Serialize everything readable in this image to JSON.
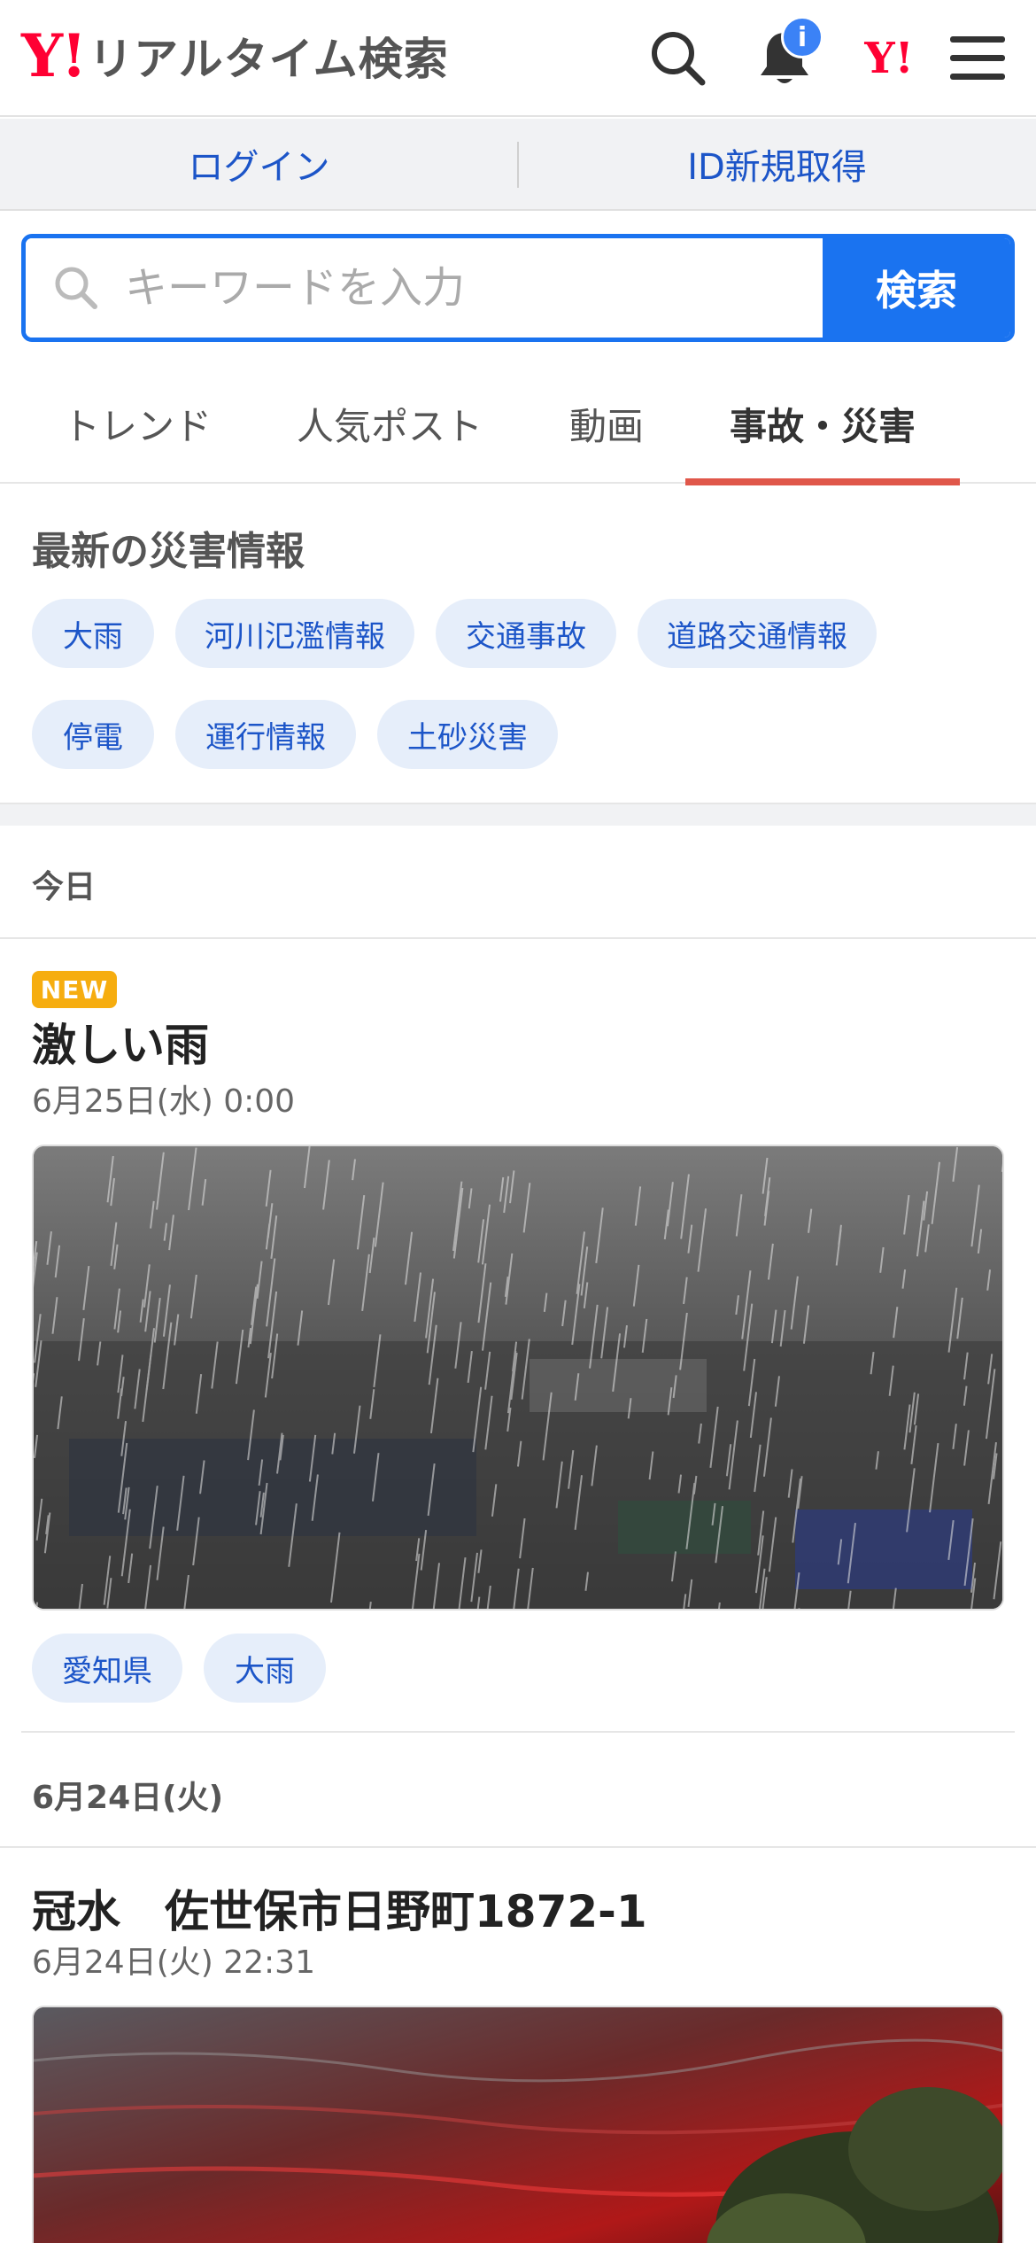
{
  "header": {
    "logo_mark": "Y!",
    "logo_text": "リアルタイム検索",
    "notification_badge": "i",
    "yahoo_mark": "Y!"
  },
  "account": {
    "login_label": "ログイン",
    "signup_label": "ID新規取得"
  },
  "search": {
    "placeholder": "キーワードを入力",
    "button_label": "検索"
  },
  "tabs": [
    {
      "label": "トレンド",
      "active": false
    },
    {
      "label": "人気ポスト",
      "active": false
    },
    {
      "label": "動画",
      "active": false
    },
    {
      "label": "事故・災害",
      "active": true
    }
  ],
  "disaster": {
    "title": "最新の災害情報",
    "chips": [
      "大雨",
      "河川氾濫情報",
      "交通事故",
      "道路交通情報",
      "停電",
      "運行情報",
      "土砂災害"
    ]
  },
  "feed": {
    "today_label": "今日",
    "post1": {
      "badge": "NEW",
      "title": "激しい雨",
      "time": "6月25日(水) 0:00",
      "image_alt": "heavy-rain-photo",
      "tags": [
        "愛知県",
        "大雨"
      ]
    },
    "day2_label": "6月24日(火)",
    "post2": {
      "title": "冠水　佐世保市日野町1872-1",
      "time": "6月24日(火) 22:31",
      "image_alt": "flooded-street-photo"
    }
  },
  "colors": {
    "brand_red": "#ff0033",
    "accent_blue": "#1a73f0",
    "link_blue": "#1c55c8",
    "tab_underline": "#e0574a",
    "new_badge": "#f6ad0f",
    "chip_bg": "#e6eefa"
  },
  "icons": [
    "search-icon",
    "bell-icon",
    "menu-icon"
  ]
}
